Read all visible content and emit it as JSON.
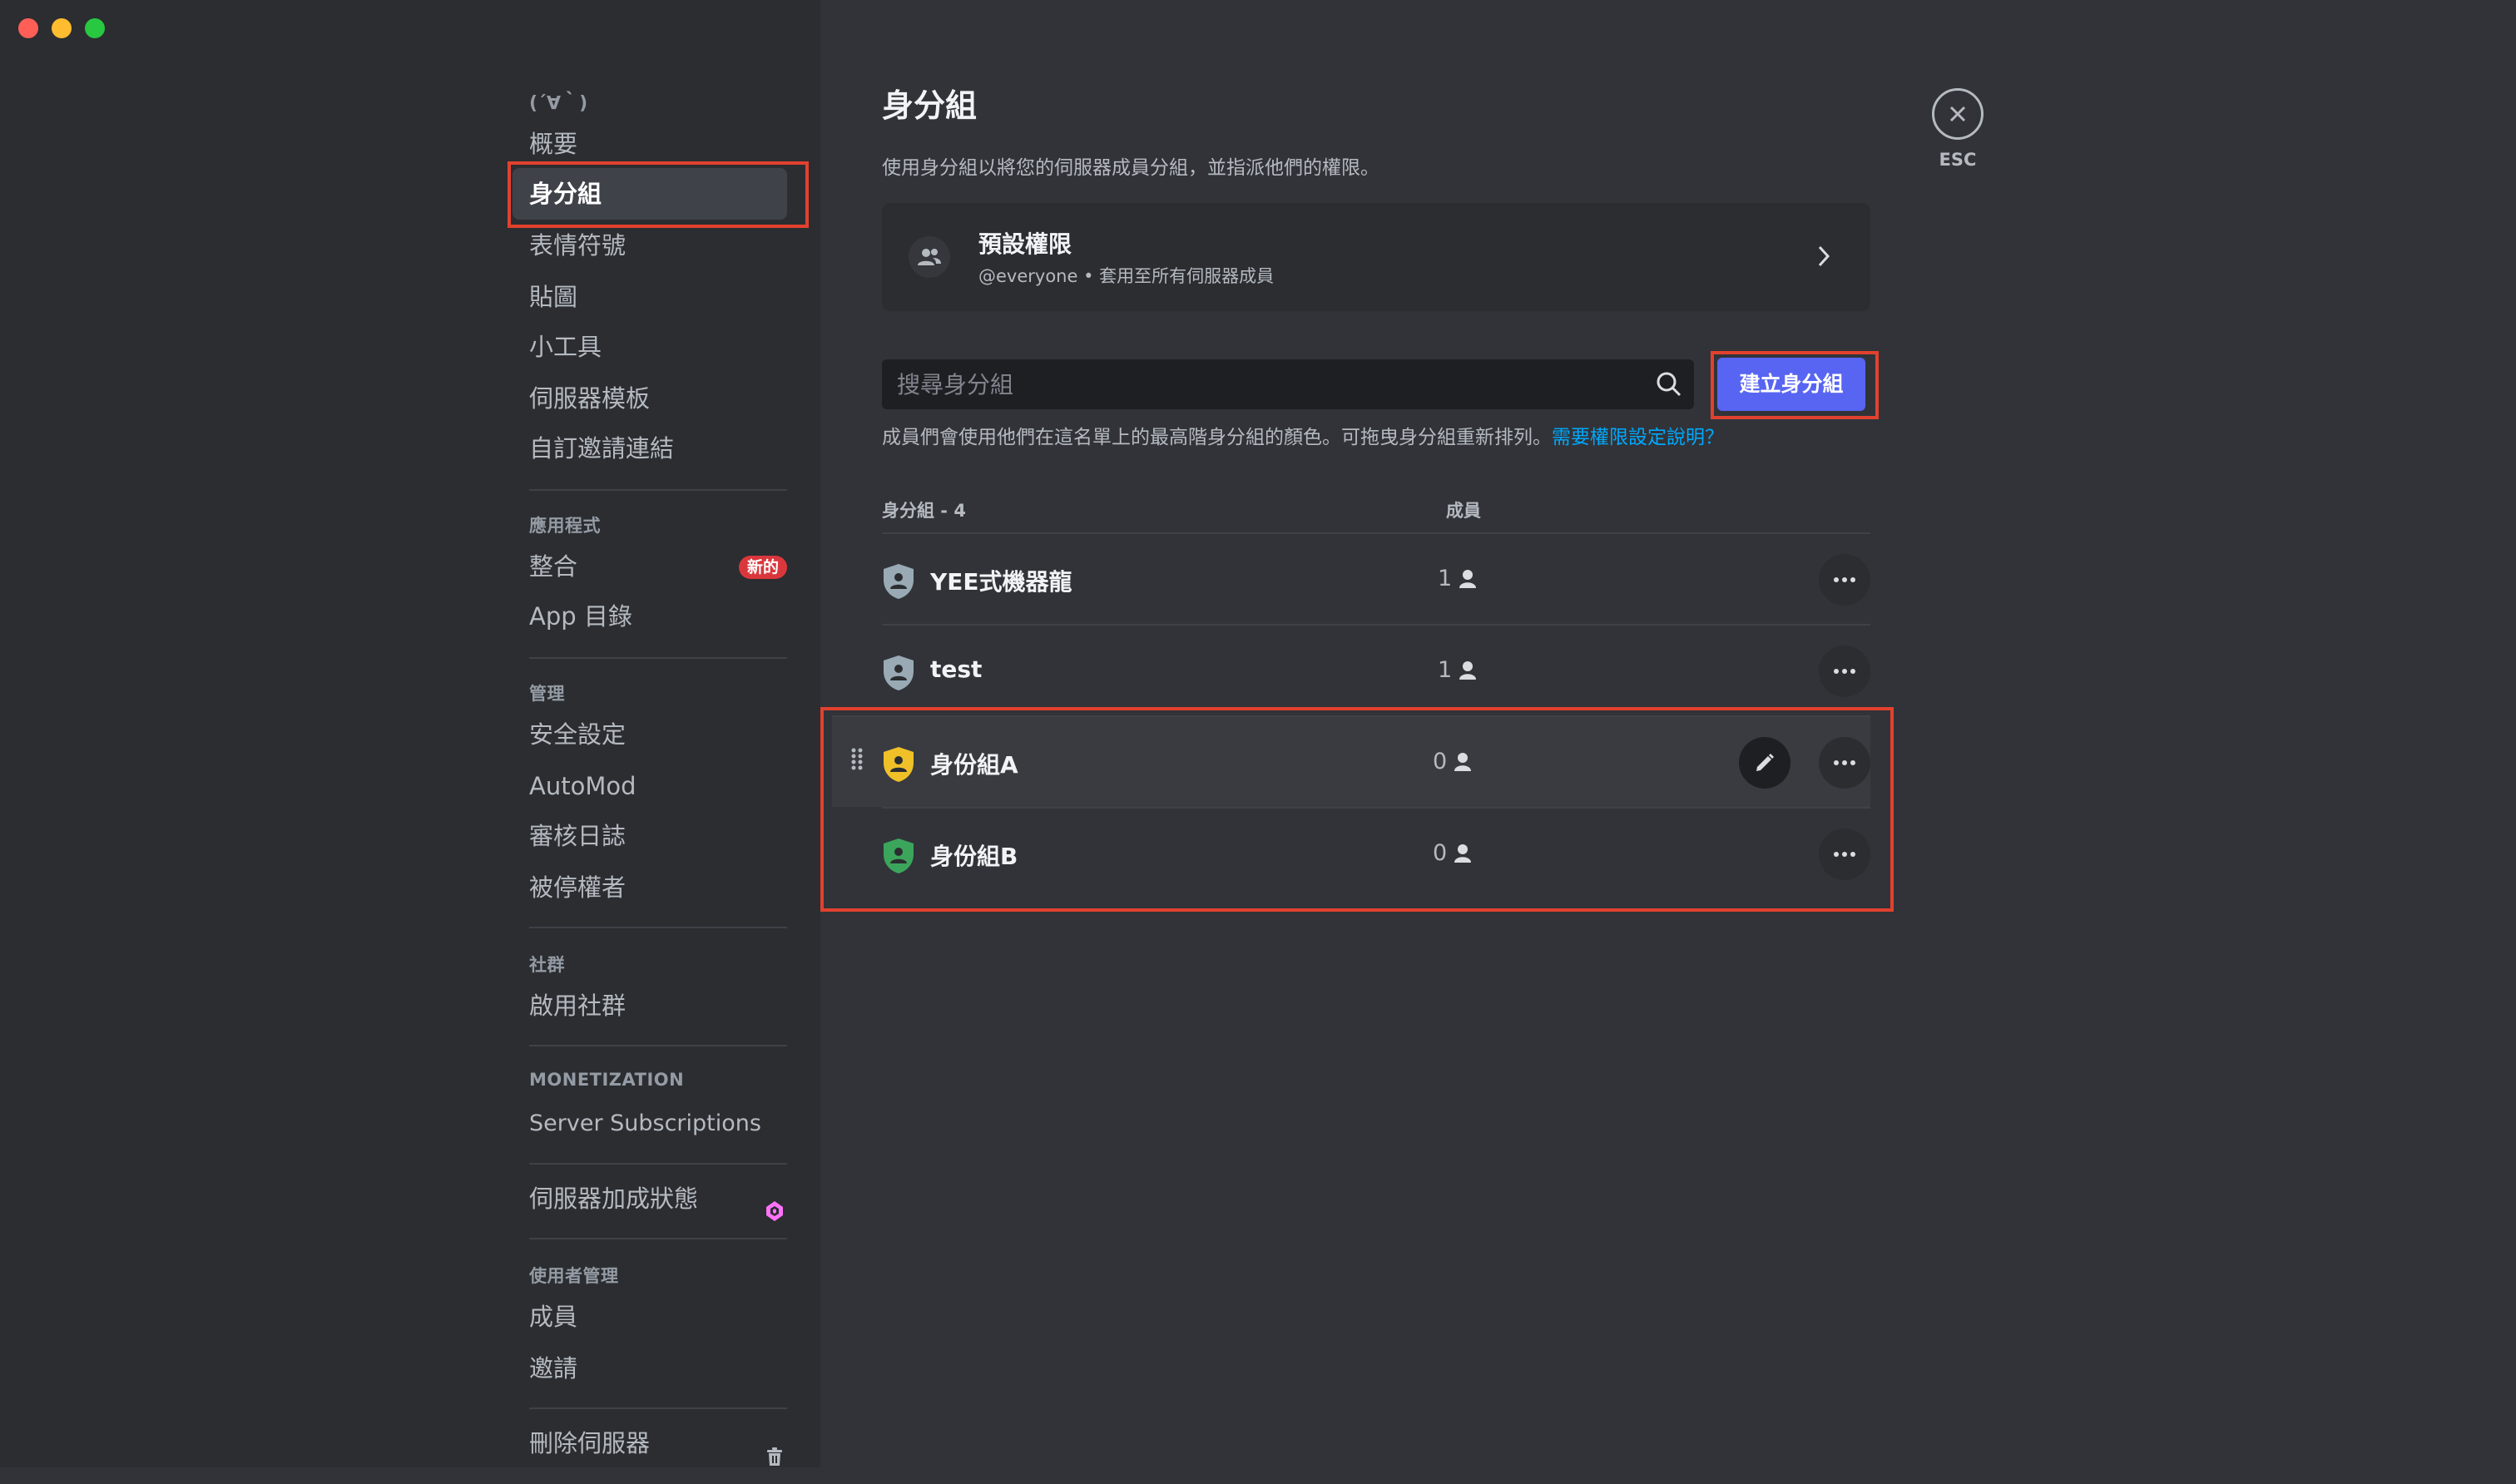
{
  "sidebar": {
    "server_name": "(´∀｀)",
    "items": [
      {
        "label": "概要"
      },
      {
        "label": "身分組"
      },
      {
        "label": "表情符號"
      },
      {
        "label": "貼圖"
      },
      {
        "label": "小工具"
      },
      {
        "label": "伺服器模板"
      },
      {
        "label": "自訂邀請連結"
      }
    ],
    "apps_header": "應用程式",
    "apps_items": [
      {
        "label": "整合",
        "badge": "新的"
      },
      {
        "label": "App 目錄"
      }
    ],
    "moderation_header": "管理",
    "moderation_items": [
      {
        "label": "安全設定"
      },
      {
        "label": "AutoMod"
      },
      {
        "label": "審核日誌"
      },
      {
        "label": "被停權者"
      }
    ],
    "community_header": "社群",
    "community_items": [
      {
        "label": "啟用社群"
      }
    ],
    "monetization_header": "MONETIZATION",
    "monetization_items": [
      {
        "label": "Server Subscriptions"
      }
    ],
    "boost_item": {
      "label": "伺服器加成狀態",
      "icon": "boost-gem-icon"
    },
    "users_header": "使用者管理",
    "users_items": [
      {
        "label": "成員"
      },
      {
        "label": "邀請"
      }
    ],
    "delete_item": {
      "label": "刪除伺服器",
      "icon": "trash-icon"
    }
  },
  "main": {
    "title": "身分組",
    "description": "使用身分組以將您的伺服器成員分組，並指派他們的權限。",
    "default_permissions": {
      "title": "預設權限",
      "subtitle": "@everyone • 套用至所有伺服器成員"
    },
    "search": {
      "placeholder": "搜尋身分組",
      "value": ""
    },
    "create_button": "建立身分組",
    "note": "成員們會使用他們在這名單上的最高階身分組的顏色。可拖曳身分組重新排列。",
    "note_link": "需要權限設定說明？",
    "columns": {
      "roles": "身分組 - 4",
      "members": "成員"
    },
    "roles": [
      {
        "name": "YEE式機器龍",
        "count": "1",
        "color": "#99aab5"
      },
      {
        "name": "test",
        "count": "1",
        "color": "#99aab5"
      },
      {
        "name": "身份組A",
        "count": "0",
        "color": "#f0c028"
      },
      {
        "name": "身份組B",
        "count": "0",
        "color": "#3ba55c"
      }
    ]
  },
  "close": {
    "label": "ESC"
  },
  "colors": {
    "accent": "#5865f2",
    "highlight": "#e1412e",
    "link": "#00a8fc",
    "badge": "#da373c"
  }
}
